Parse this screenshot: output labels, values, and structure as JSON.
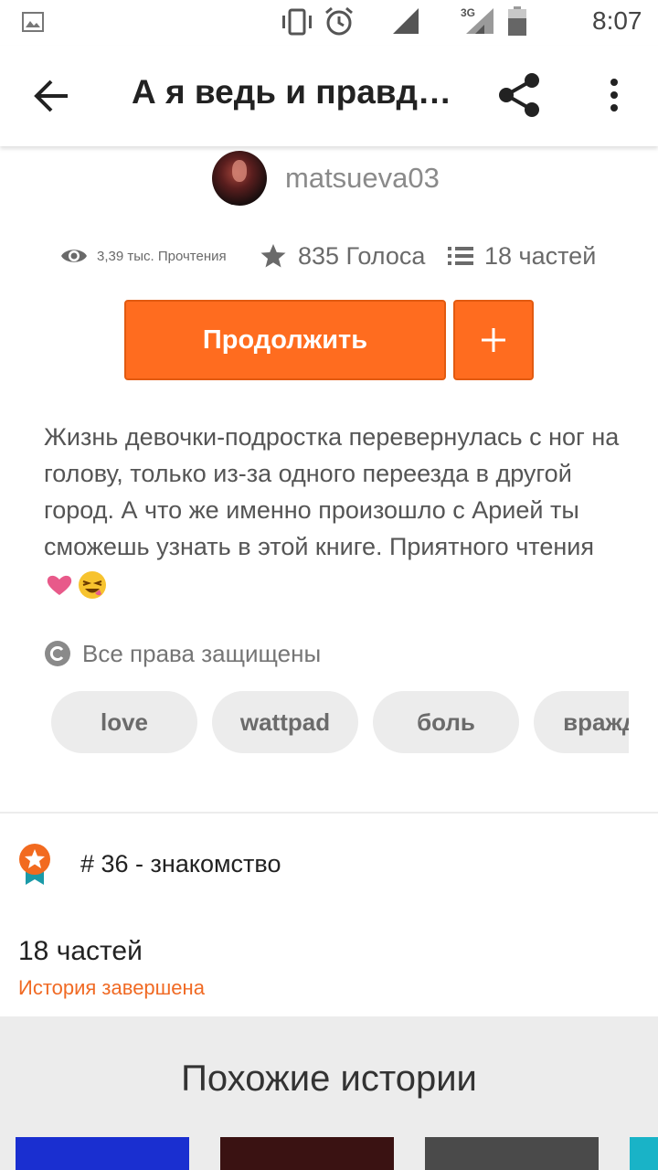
{
  "status_bar": {
    "time": "8:07",
    "network": "3G",
    "icons": [
      "image-icon",
      "vibrate-icon",
      "alarm-icon",
      "signal-icon",
      "signal-3g-icon",
      "battery-icon"
    ]
  },
  "toolbar": {
    "title": "А я ведь и правд…"
  },
  "author": {
    "username": "matsueva03"
  },
  "stats": {
    "reads": "3,39 тыс. Прочтения",
    "votes": "835 Голоса",
    "parts": "18 частей"
  },
  "actions": {
    "continue_label": "Продолжить"
  },
  "description": {
    "text": "Жизнь девочки-подростка перевернулась с ног на голову, только из-за одного переезда в другой город. А что же именно произошло с Арией ты сможешь узнать в этой книге. Приятного чтения"
  },
  "copyright": {
    "label": "Все права защищены"
  },
  "tags": [
    "love",
    "wattpad",
    "боль",
    "вражда"
  ],
  "ranking": {
    "label": "# 36 - знакомство"
  },
  "parts_info": {
    "count": "18 частей",
    "status": "История завершена"
  },
  "similar": {
    "title": "Похожие истории"
  },
  "colors": {
    "accent": "#ff6c1f",
    "status_orange": "#f06a24",
    "tag_bg": "#ececec"
  }
}
